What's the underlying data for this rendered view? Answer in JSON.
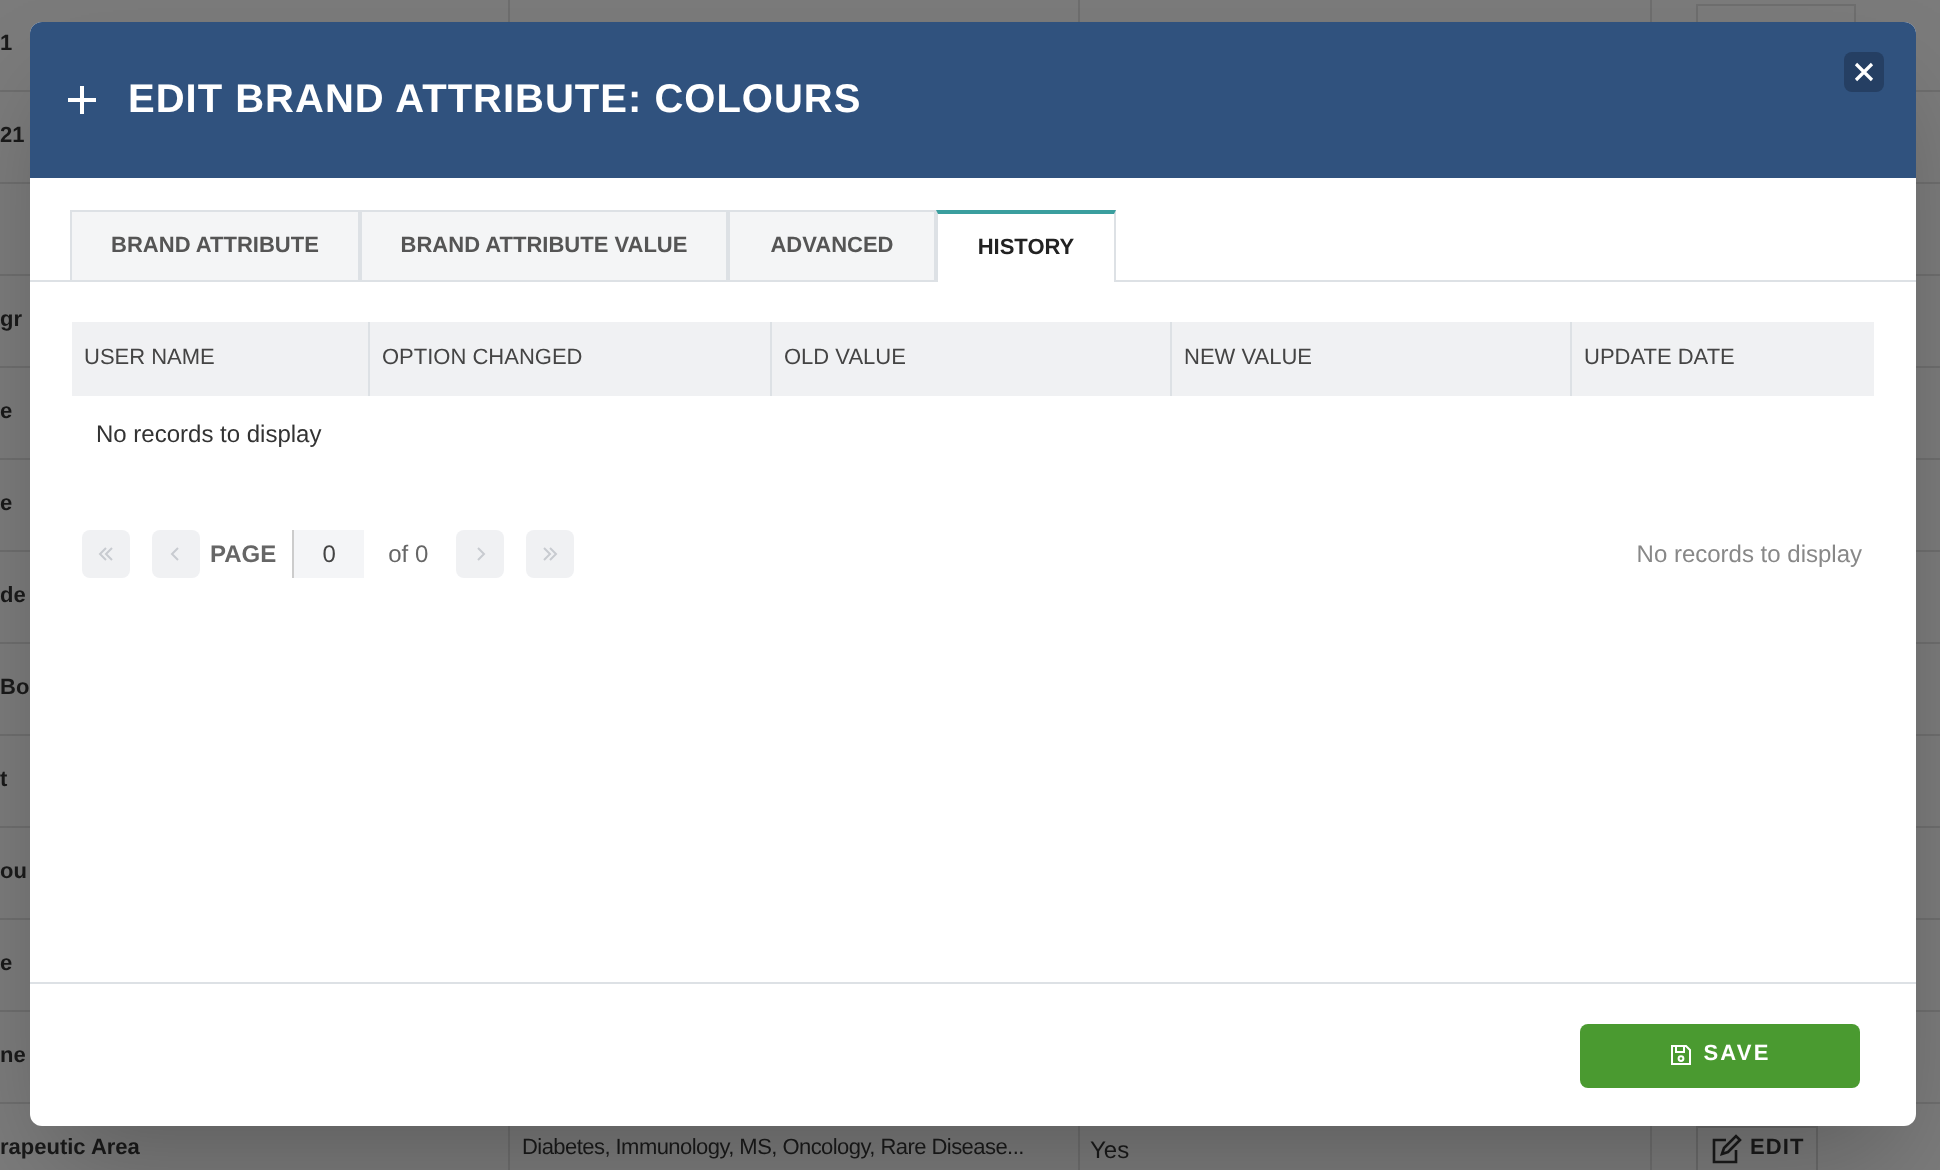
{
  "background_table": {
    "rows": [
      {
        "column_1": "1"
      },
      {
        "column_1": "21"
      },
      {
        "column_1": ""
      },
      {
        "column_1": "gr"
      },
      {
        "column_1": "e"
      },
      {
        "column_1": "e"
      },
      {
        "column_1": "de"
      },
      {
        "column_1": "Bo"
      },
      {
        "column_1": "t"
      },
      {
        "column_1": "ou"
      },
      {
        "column_1": "e"
      },
      {
        "column_1": "ne"
      },
      {
        "column_1": "rapeutic Area",
        "column_2": "Diabetes, Immunology, MS, Oncology, Rare Disease...",
        "column_3": "Yes",
        "action": "EDIT"
      }
    ]
  },
  "modal": {
    "title": "EDIT BRAND ATTRIBUTE: COLOURS",
    "tabs": [
      {
        "label": "BRAND ATTRIBUTE",
        "selected": false
      },
      {
        "label": "BRAND ATTRIBUTE VALUE",
        "selected": false
      },
      {
        "label": "ADVANCED",
        "selected": false
      },
      {
        "label": "HISTORY",
        "selected": true
      }
    ],
    "table": {
      "columns": [
        "USER NAME",
        "OPTION CHANGED",
        "OLD VALUE",
        "NEW VALUE",
        "UPDATE DATE"
      ],
      "empty_message": "No records to display"
    },
    "pager": {
      "page_label": "PAGE",
      "page_value": "0",
      "of_label": "of 0",
      "status": "No records to display"
    },
    "save_button": "SAVE"
  }
}
